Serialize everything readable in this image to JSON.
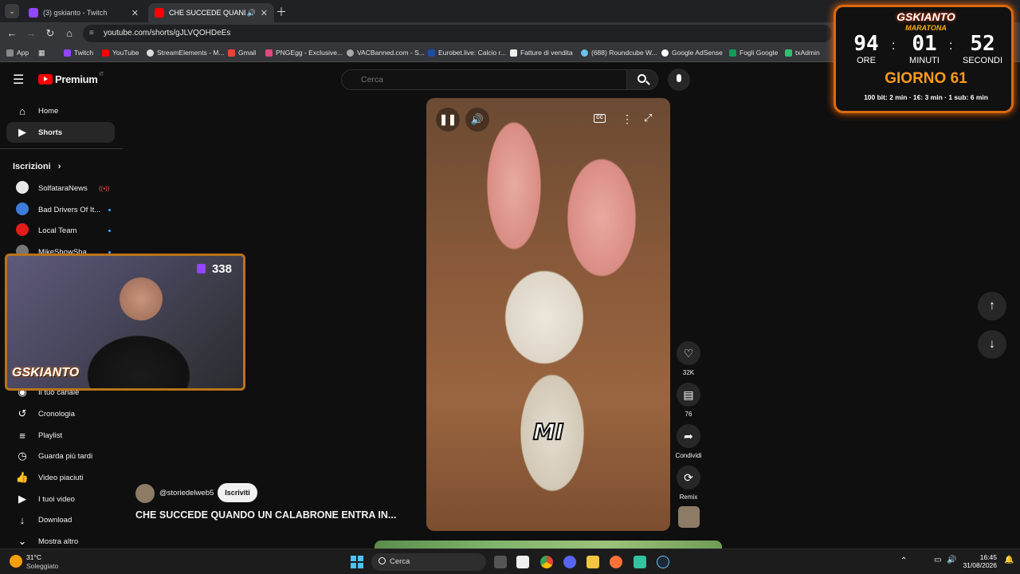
{
  "browser": {
    "tabs": [
      {
        "title": "(3) gskianto - Twitch",
        "active": false
      },
      {
        "title": "CHE SUCCEDE QUANDO UN",
        "active": true
      }
    ],
    "url": "youtube.com/shorts/gJLVQOHDeEs",
    "bookmarks": [
      "App",
      "Twitch",
      "YouTube",
      "StreamElements - M...",
      "Gmail",
      "PNGEgg - Exclusive...",
      "VACBanned.com - S...",
      "Eurobet.live: Calcio r...",
      "Fatture di vendita",
      "(688) Roundcube W...",
      "Google AdSense",
      "Fogli Google",
      "txAdmin"
    ]
  },
  "youtube": {
    "logo": "Premium",
    "logo_region": "IT",
    "search_placeholder": "Cerca",
    "sidebar": {
      "main": [
        {
          "label": "Home"
        },
        {
          "label": "Shorts"
        }
      ],
      "subscriptions_heading": "Iscrizioni",
      "subscriptions": [
        {
          "label": "SolfataraNews"
        },
        {
          "label": "Bad Drivers Of It..."
        },
        {
          "label": "Local Team"
        },
        {
          "label": "MikeShowSha"
        }
      ],
      "you": [
        {
          "label": "Il tuo canale"
        },
        {
          "label": "Cronologia"
        },
        {
          "label": "Playlist"
        },
        {
          "label": "Guarda più tardi"
        },
        {
          "label": "Video piaciuti"
        },
        {
          "label": "I tuoi video"
        },
        {
          "label": "Download"
        },
        {
          "label": "Mostra altro"
        }
      ]
    },
    "short": {
      "channel": "@storiedelweb5",
      "subscribe_label": "Iscriviti",
      "title": "CHE SUCCEDE QUANDO UN CALABRONE ENTRA IN...",
      "caption_word": "MI",
      "cc_label": "CC",
      "actions": {
        "likes": "32K",
        "comments": "76",
        "share": "Condividi",
        "remix": "Remix"
      }
    }
  },
  "overlay": {
    "timer": {
      "brand": "GSKIANTO",
      "subtitle": "MARATONA",
      "hours": "94",
      "minutes": "01",
      "seconds": "52",
      "hours_label": "ORE",
      "minutes_label": "MINUTI",
      "seconds_label": "SECONDI",
      "day": "GIORNO 61",
      "rates": "100 bit: 2 min · 1€: 3 min · 1 sub: 6 min"
    },
    "webcam": {
      "viewers": "338",
      "logo": "GSKIANTO"
    }
  },
  "taskbar": {
    "weather_temp": "31°C",
    "weather_desc": "Soleggiato",
    "search_placeholder": "Cerca",
    "time": "16:45",
    "date": "31/08/2026"
  }
}
